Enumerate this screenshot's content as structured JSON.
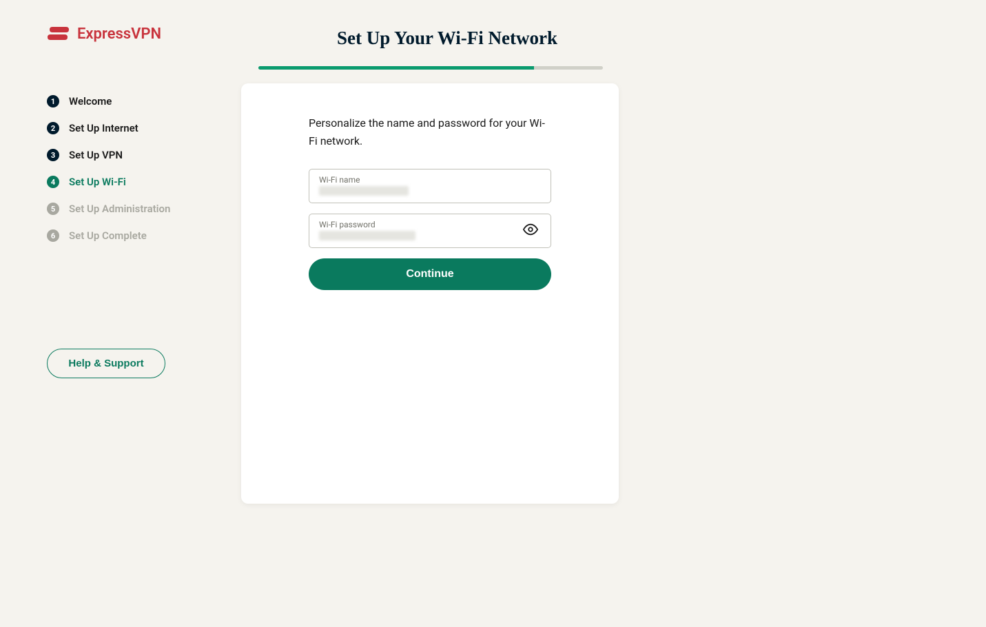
{
  "brand": {
    "name": "ExpressVPN",
    "color": "#c8333c"
  },
  "sidebar": {
    "steps": [
      {
        "num": "1",
        "label": "Welcome",
        "state": "done"
      },
      {
        "num": "2",
        "label": "Set Up Internet",
        "state": "done"
      },
      {
        "num": "3",
        "label": "Set Up VPN",
        "state": "done"
      },
      {
        "num": "4",
        "label": "Set Up Wi-Fi",
        "state": "current"
      },
      {
        "num": "5",
        "label": "Set Up Administration",
        "state": "upcoming"
      },
      {
        "num": "6",
        "label": "Set Up Complete",
        "state": "upcoming"
      }
    ],
    "help_label": "Help & Support"
  },
  "page": {
    "title": "Set Up Your Wi-Fi Network",
    "progress_percent": 80
  },
  "form": {
    "description": "Personalize the name and password for your Wi-Fi network.",
    "wifi_name_label": "Wi-Fi name",
    "wifi_password_label": "Wi-Fi password",
    "continue_label": "Continue"
  },
  "colors": {
    "accent": "#0a7a5e",
    "progress": "#0a9b6e",
    "dark": "#001a2c",
    "muted": "#a8a8a0",
    "bg": "#f5f3ee"
  }
}
